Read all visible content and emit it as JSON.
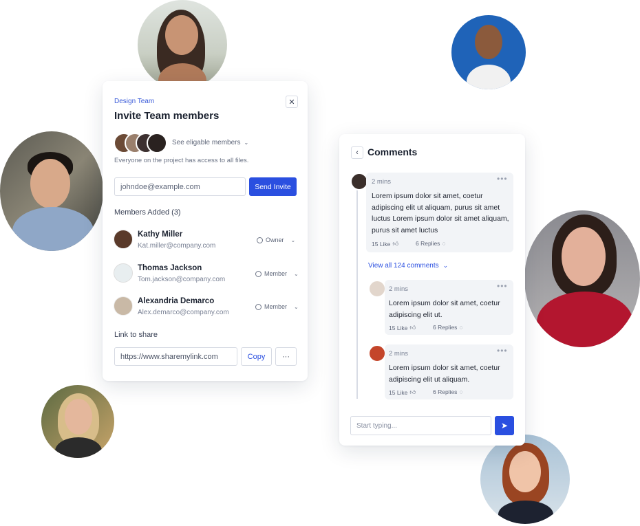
{
  "invite": {
    "team_label": "Design Team",
    "title": "Invite Team members",
    "see_members": "See eligable members",
    "access_note": "Everyone on the project has access to all files.",
    "email_placeholder": "johndoe@example.com",
    "send_label": "Send Invite",
    "members_heading": "Members Added (3)",
    "members": [
      {
        "name": "Kathy Miller",
        "email": "Kat.miller@company.com",
        "role": "Owner"
      },
      {
        "name": "Thomas Jackson",
        "email": "Tom.jackson@company.com",
        "role": "Member"
      },
      {
        "name": "Alexandria Demarco",
        "email": "Alex.demarco@company.com",
        "role": "Member"
      }
    ],
    "link_label": "Link to share",
    "link_value": "https://www.sharemylink.com",
    "copy_label": "Copy",
    "more_label": "···"
  },
  "comments": {
    "title": "Comments",
    "items": [
      {
        "time": "2 mins",
        "text": "Lorem ipsum dolor sit amet, coetur adipiscing elit ut aliquam, purus sit amet luctus Lorem ipsum dolor sit amet aliquam, purus sit amet luctus",
        "likes": "15 Like",
        "replies": "6 Replies"
      },
      {
        "time": "2 mins",
        "text": "Lorem ipsum dolor sit amet, coetur adipiscing elit ut.",
        "likes": "15 Like",
        "replies": "6 Replies"
      },
      {
        "time": "2 mins",
        "text": "Lorem ipsum dolor sit amet, coetur adipiscing elit ut aliquam.",
        "likes": "15 Like",
        "replies": "6 Replies"
      }
    ],
    "view_all": "View all 124 comments",
    "input_placeholder": "Start typing..."
  },
  "colors": {
    "accent": "#2a4fe0",
    "accent_text": "#3a5bd9"
  }
}
